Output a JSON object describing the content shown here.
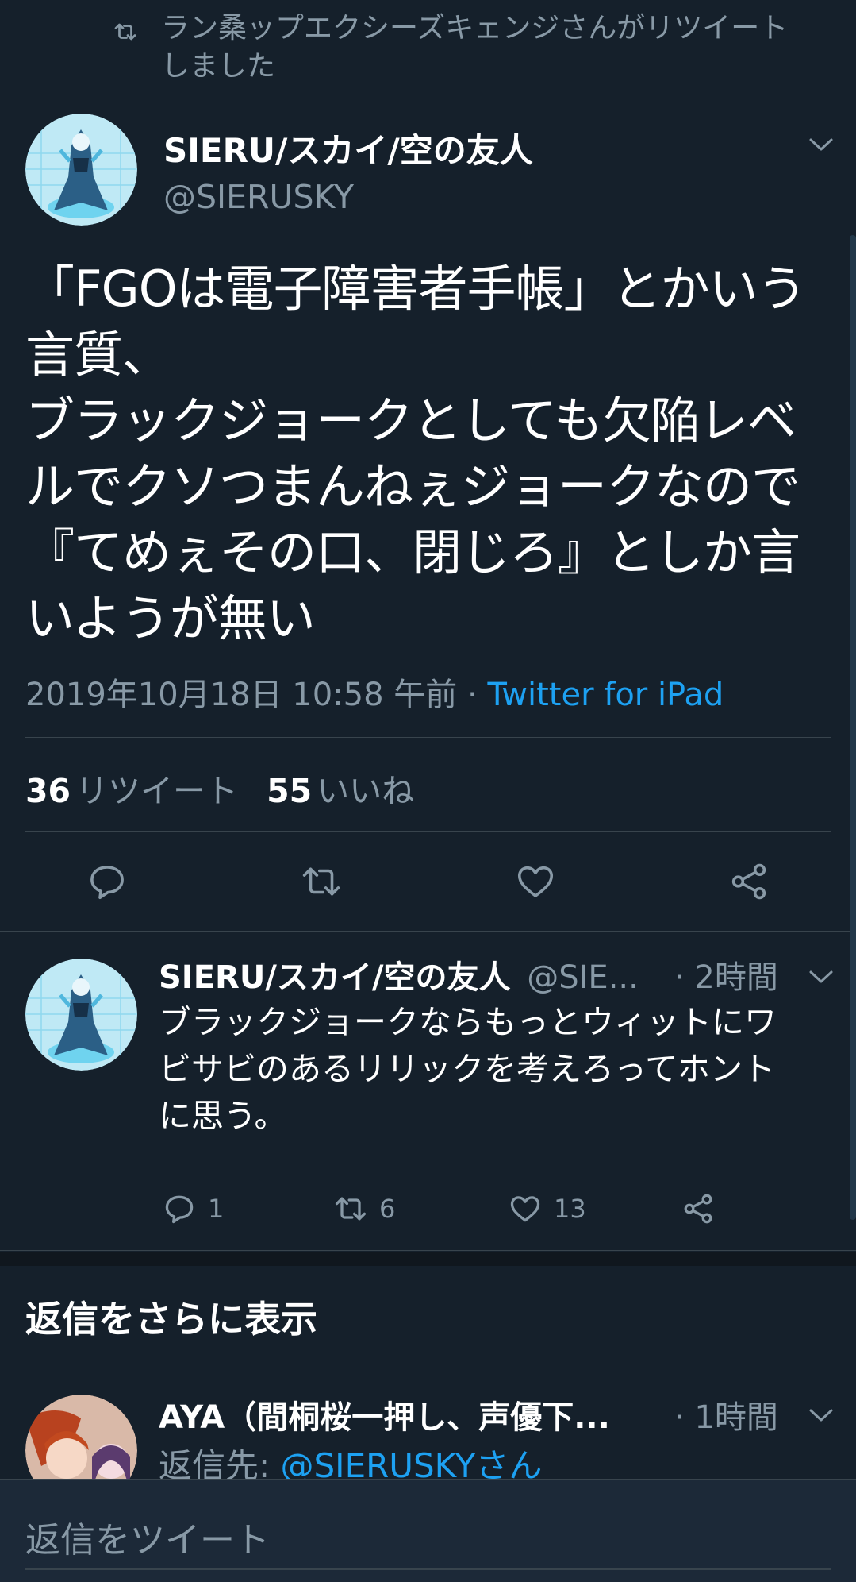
{
  "retweet_banner": {
    "icon": "retweet-icon",
    "text": "ラン桑ップエクシーズキェンジさんがリツイート\nしました"
  },
  "main_tweet": {
    "display_name": "SIERU/スカイ/空の友人",
    "handle": "@SIERUSKY",
    "body": "「FGOは電子障害者手帳」とかいう\n言質、\nブラックジョークとしても欠陥レベ\nルでクソつまんねぇジョークなので\n『てめぇその口、閉じろ』としか言\nいようが無い",
    "timestamp": "2019年10月18日 10:58 午前",
    "separator": " · ",
    "source": "Twitter for iPad",
    "retweet_count": "36",
    "retweet_label": "リツイート",
    "like_count": "55",
    "like_label": "いいね"
  },
  "reply_1": {
    "display_name": "SIERU/スカイ/空の友人",
    "handle": "@SIE...",
    "time": "· 2時間",
    "body": "ブラックジョークならもっとウィットにワ\nビサビのあるリリックを考えろってホント\nに思う。",
    "reply_count": "1",
    "retweet_count": "6",
    "like_count": "13"
  },
  "more_replies_label": "返信をさらに表示",
  "reply_2": {
    "display_name": "AYA（間桐桜一押し、声優下...",
    "time": "· 1時間",
    "reply_to_label": "返信先: ",
    "reply_to_mention": "@SIERUSKYさん"
  },
  "compose": {
    "placeholder": "返信をツイート"
  },
  "colors": {
    "background": "#15202b",
    "secondary_text": "#8899a6",
    "accent": "#1da1f2",
    "divider": "#38444d"
  }
}
